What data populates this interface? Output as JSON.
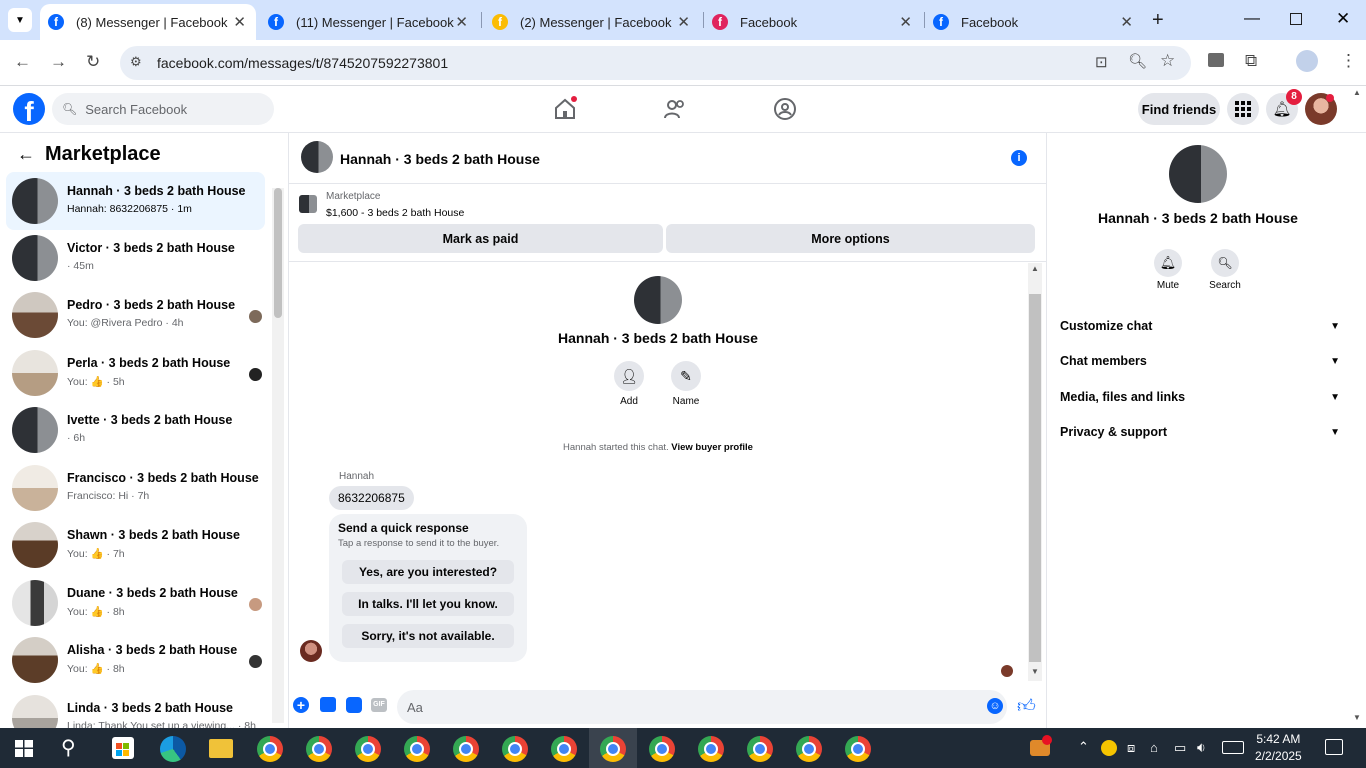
{
  "browser": {
    "tabs": [
      {
        "title": "(8) Messenger | Facebook",
        "active": true
      },
      {
        "title": "(11) Messenger | Facebook",
        "active": false
      },
      {
        "title": "(2) Messenger | Facebook",
        "active": false
      },
      {
        "title": "Facebook",
        "active": false
      },
      {
        "title": "Facebook",
        "active": false
      }
    ],
    "url": "facebook.com/messages/t/8745207592273801"
  },
  "fb": {
    "search_placeholder": "Search Facebook",
    "find_friends": "Find friends",
    "notif_count": "8"
  },
  "sidebar": {
    "title": "Marketplace",
    "conversations": [
      {
        "name": "Hannah · 3 beds 2 bath House",
        "preview": "Hannah: 8632206875 · 1m",
        "active": true
      },
      {
        "name": "Victor · 3 beds 2 bath House",
        "preview": "· 45m"
      },
      {
        "name": "Pedro · 3 beds 2 bath House",
        "preview": "You: @Rivera Pedro · 4h"
      },
      {
        "name": "Perla · 3 beds 2 bath House",
        "preview": "You: 👍 · 5h"
      },
      {
        "name": "Ivette · 3 beds 2 bath House",
        "preview": "· 6h"
      },
      {
        "name": "Francisco · 3 beds 2 bath House",
        "preview": "Francisco: Hi · 7h"
      },
      {
        "name": "Shawn · 3 beds 2 bath House",
        "preview": "You: 👍 · 7h"
      },
      {
        "name": "Duane · 3 beds 2 bath House",
        "preview": "You: 👍 · 8h"
      },
      {
        "name": "Alisha · 3 beds 2 bath House",
        "preview": "You: 👍 · 8h"
      },
      {
        "name": "Linda · 3 beds 2 bath House",
        "preview": "Linda: Thank You set up a viewing... · 8h"
      }
    ]
  },
  "chat": {
    "title": "Hannah · 3 beds 2 bath House",
    "listing_label": "Marketplace",
    "listing_price": "$1,600 - 3 beds 2 bath House",
    "mark_paid": "Mark as paid",
    "more_options": "More options",
    "profile_name": "Hannah · 3 beds 2 bath House",
    "add_label": "Add",
    "name_label": "Name",
    "started_text": "Hannah started this chat.",
    "view_profile": "View buyer profile",
    "sender": "Hannah",
    "message": "8632206875",
    "quick_title": "Send a quick response",
    "quick_sub": "Tap a response to send it to the buyer.",
    "quick_responses": [
      "Yes, are you interested?",
      "In talks. I'll let you know.",
      "Sorry, it's not available."
    ],
    "composer_placeholder": "Aa"
  },
  "details": {
    "name": "Hannah · 3 beds 2 bath House",
    "mute": "Mute",
    "search": "Search",
    "sections": [
      "Customize chat",
      "Chat members",
      "Media, files and links",
      "Privacy & support"
    ]
  },
  "taskbar": {
    "time": "5:42 AM",
    "date": "2/2/2025"
  },
  "colors": {
    "fb_blue": "#0866ff",
    "tab_strip": "#d3e3fd",
    "taskbar": "#1f2a36"
  }
}
